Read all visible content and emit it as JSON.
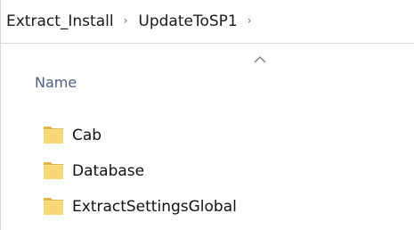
{
  "breadcrumb": {
    "items": [
      "Extract_Install",
      "UpdateToSP1"
    ],
    "separator": "›"
  },
  "columns": {
    "name_header": "Name"
  },
  "files": [
    {
      "name": "Cab",
      "type": "folder"
    },
    {
      "name": "Database",
      "type": "folder"
    },
    {
      "name": "ExtractSettingsGlobal",
      "type": "folder"
    }
  ],
  "colors": {
    "folder_body": "#f8d775",
    "folder_shade": "#e6b23d",
    "header_text": "#4d6082"
  },
  "icons": {
    "folder": "folder-icon",
    "sort": "sort-ascending-icon",
    "chevron": "chevron-right-icon"
  }
}
